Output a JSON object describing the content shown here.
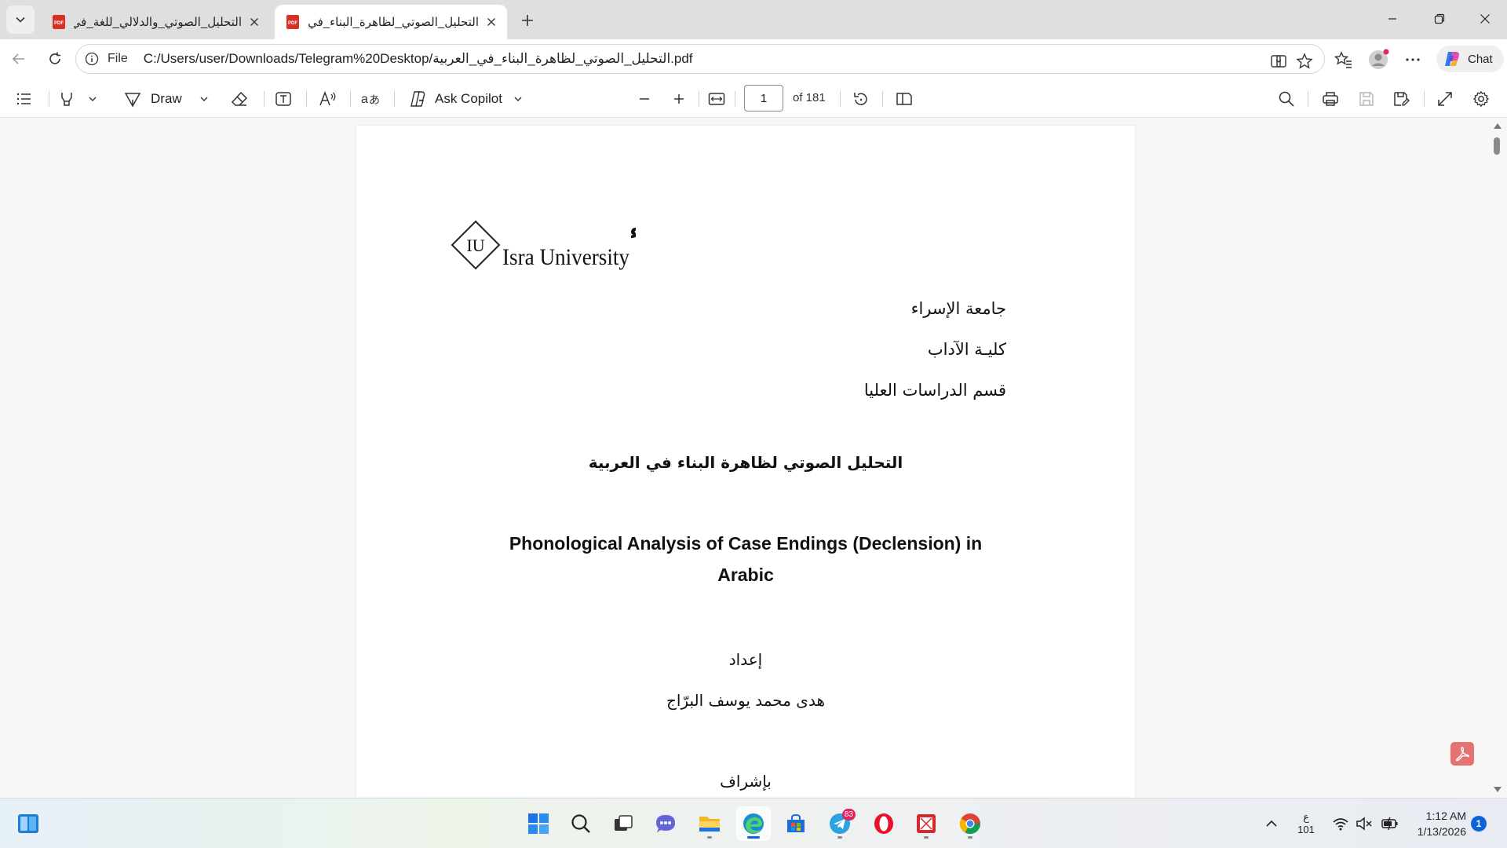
{
  "browser": {
    "tabs": [
      {
        "title": "التحليل_الصوتي_والدلالي_للغة_في_ا",
        "active": false
      },
      {
        "title": "التحليل_الصوتي_لظاهرة_البناء_في_ال",
        "active": true
      }
    ],
    "address": {
      "scheme": "File",
      "url": "C:/Users/user/Downloads/Telegram%20Desktop/التحليل_الصوتي_لظاهرة_البناء_في_العربية.pdf"
    },
    "chat_label": "Chat"
  },
  "pdf_toolbar": {
    "draw_label": "Draw",
    "ask_copilot_label": "Ask Copilot",
    "page_number": "1",
    "page_count": "of 181"
  },
  "document": {
    "logo_arabic": "جامعة الإسراء",
    "logo_english": "Isra University",
    "logo_mark": "IU",
    "header_lines": [
      "جامعة الإسراء",
      "كليـة الآداب",
      "قسم الدراسات العليا"
    ],
    "title_arabic": "التحليل الصوتي لظاهرة البناء في العربية",
    "title_english_line1": "Phonological Analysis of Case Endings (Declension) in",
    "title_english_line2": "Arabic",
    "prepared_by_label": "إعداد",
    "author": "هدى محمد يوسف البرّاج",
    "supervision_label": "بإشراف"
  },
  "taskbar": {
    "telegram_badge": "83",
    "ime_line1": "ع",
    "ime_line2": "101",
    "time": "1:12 AM",
    "date": "1/13/2026",
    "notification_count": "1"
  },
  "colors": {
    "tabstrip": "#dfdfdf",
    "accent": "#0a64d8",
    "pdf_red": "#d93025"
  }
}
